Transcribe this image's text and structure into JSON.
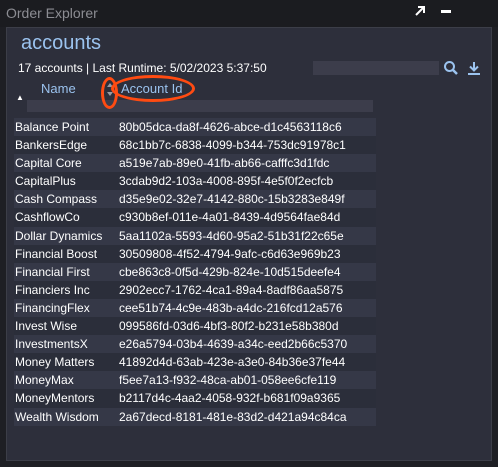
{
  "window": {
    "title": "Order Explorer"
  },
  "view": {
    "title": "accounts",
    "summary": "17 accounts | Last Runtime: 5/02/2023 5:37:50",
    "search_value": ""
  },
  "columns": {
    "name": "Name",
    "account_id": "Account Id"
  },
  "icons": {
    "popout": "popout-arrow-icon",
    "close": "close-icon",
    "search": "search-icon",
    "download": "download-icon",
    "sort": "sort-ascending-icon",
    "sort_toggle": "sort-toggle-icon"
  },
  "colors": {
    "accent": "#9bc3ef",
    "annotation": "#ff4b12",
    "panel": "#2d2f3b"
  },
  "rows": [
    {
      "name": "Balance Point",
      "id": "80b05dca-da8f-4626-abce-d1c4563118c6"
    },
    {
      "name": "BankersEdge",
      "id": "68c1bb7c-6838-4099-b344-753dc91978c1"
    },
    {
      "name": "Capital Core",
      "id": "a519e7ab-89e0-41fb-ab66-cafffc3d1fdc"
    },
    {
      "name": "CapitalPlus",
      "id": "3cdab9d2-103a-4008-895f-4e5f0f2ecfcb"
    },
    {
      "name": "Cash Compass",
      "id": "d35e9e02-32e7-4142-880c-15b3283e849f"
    },
    {
      "name": "CashflowCo",
      "id": "c930b8ef-011e-4a01-8439-4d9564fae84d"
    },
    {
      "name": "Dollar Dynamics",
      "id": "5aa1102a-5593-4d60-95a2-51b31f22c65e"
    },
    {
      "name": "Financial Boost",
      "id": "30509808-4f52-4794-9afc-c6d63e969b23"
    },
    {
      "name": "Financial First",
      "id": "cbe863c8-0f5d-429b-824e-10d515deefe4"
    },
    {
      "name": "Financiers Inc",
      "id": "2902ecc7-1762-4ca1-89a4-8adf86aa5875"
    },
    {
      "name": "FinancingFlex",
      "id": "cee51b74-4c9e-483b-a4dc-216fcd12a576"
    },
    {
      "name": "Invest Wise",
      "id": "099586fd-03d6-4bf3-80f2-b231e58b380d"
    },
    {
      "name": "InvestmentsX",
      "id": "e26a5794-03b4-4639-a34c-eed2b66c5370"
    },
    {
      "name": "Money Matters",
      "id": "41892d4d-63ab-423e-a3e0-84b36e37fe44"
    },
    {
      "name": "MoneyMax",
      "id": "f5ee7a13-f932-48ca-ab01-058ee6cfe119"
    },
    {
      "name": "MoneyMentors",
      "id": "b2117d4c-4aa2-4058-932f-b681f09a9365"
    },
    {
      "name": "Wealth Wisdom",
      "id": "2a67decd-8181-481e-83d2-d421a94c84ca"
    }
  ]
}
